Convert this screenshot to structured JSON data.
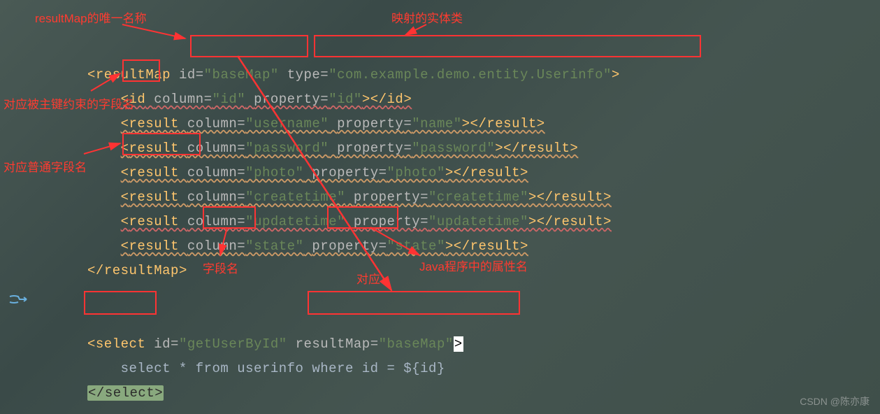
{
  "annotations": {
    "resultMapName": "resultMap的唯一名称",
    "entityClass": "映射的实体类",
    "primaryKeyField": "对应被主键约束的字段名",
    "normalField": "对应普通字段名",
    "columnName": "字段名",
    "correspond": "对应",
    "javaProp": "Java程序中的属性名",
    "watermark": "CSDN @陈亦康"
  },
  "code": {
    "resultMap": {
      "idAttr": "\"baseMap\"",
      "typeAttr": "\"com.example.demo.entity.Userinfo\"",
      "rows": [
        {
          "tag": "id",
          "column": "\"id\"",
          "property": "\"id\""
        },
        {
          "tag": "result",
          "column": "\"username\"",
          "property": "\"name\""
        },
        {
          "tag": "result",
          "column": "\"password\"",
          "property": "\"password\""
        },
        {
          "tag": "result",
          "column": "\"photo\"",
          "property": "\"photo\""
        },
        {
          "tag": "result",
          "column": "\"createtime\"",
          "property": "\"createtime\""
        },
        {
          "tag": "result",
          "column": "\"updatetime\"",
          "property": "\"updatetime\""
        },
        {
          "tag": "result",
          "column": "\"state\"",
          "property": "\"state\""
        }
      ]
    },
    "select": {
      "idAttr": "\"getUserById\"",
      "resultMapAttr": "\"baseMap\"",
      "sql": "select * from userinfo where id = ${id}"
    },
    "keywords": {
      "resultMapOpen": "resultMap",
      "idKeyword": "id",
      "typeKeyword": "type",
      "columnKeyword": "column",
      "propertyKeyword": "property",
      "selectKeyword": "select",
      "resultMapAttrKw": "resultMap"
    }
  }
}
